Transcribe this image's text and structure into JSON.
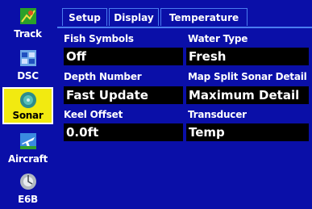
{
  "sidebar": {
    "items": [
      {
        "label": "Track",
        "icon": "track-icon",
        "active": false
      },
      {
        "label": "DSC",
        "icon": "dsc-icon",
        "active": false
      },
      {
        "label": "Sonar",
        "icon": "sonar-icon",
        "active": true
      },
      {
        "label": "Aircraft",
        "icon": "aircraft-icon",
        "active": false
      },
      {
        "label": "E6B",
        "icon": "e6b-icon",
        "active": false
      }
    ]
  },
  "tabs": [
    {
      "label": "Setup",
      "active": true
    },
    {
      "label": "Display",
      "active": false
    },
    {
      "label": "Temperature",
      "active": false
    }
  ],
  "fields": {
    "fish_symbols": {
      "label": "Fish Symbols",
      "value": "Off"
    },
    "water_type": {
      "label": "Water Type",
      "value": "Fresh"
    },
    "depth_number": {
      "label": "Depth Number",
      "value": "Fast Update"
    },
    "map_split": {
      "label": "Map Split Sonar Detail",
      "value": "Maximum Detail"
    },
    "keel_offset": {
      "label": "Keel Offset",
      "value": "0.0ft"
    },
    "transducer": {
      "label": "Transducer",
      "value": "Temp"
    }
  },
  "colors": {
    "background": "#0a0fa8",
    "active_highlight": "#f2ea10",
    "field_bg": "#000000",
    "tab_border": "#4a7df0"
  }
}
